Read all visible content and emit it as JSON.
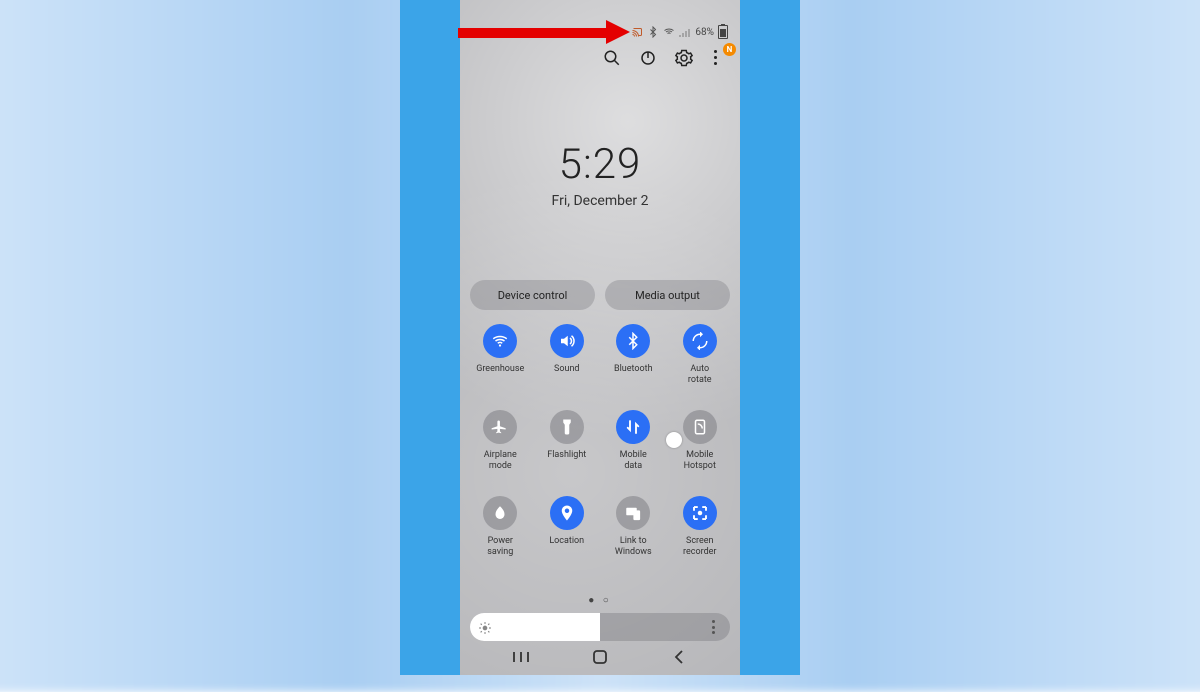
{
  "status": {
    "battery_pct": "68%",
    "badge_letter": "N"
  },
  "clock": {
    "time": "5:29",
    "date": "Fri, December 2"
  },
  "pills": {
    "device_control": "Device control",
    "media_output": "Media output"
  },
  "tiles": [
    {
      "id": "wifi",
      "label": "Greenhouse",
      "on": true
    },
    {
      "id": "sound",
      "label": "Sound",
      "on": true
    },
    {
      "id": "bluetooth",
      "label": "Bluetooth",
      "on": true
    },
    {
      "id": "auto-rotate",
      "label": "Auto\nrotate",
      "on": true
    },
    {
      "id": "airplane",
      "label": "Airplane\nmode",
      "on": false
    },
    {
      "id": "flashlight",
      "label": "Flashlight",
      "on": false
    },
    {
      "id": "mobile-data",
      "label": "Mobile\ndata",
      "on": true
    },
    {
      "id": "hotspot",
      "label": "Mobile\nHotspot",
      "on": false,
      "toggle_dot": true
    },
    {
      "id": "power-saving",
      "label": "Power\nsaving",
      "on": false
    },
    {
      "id": "location",
      "label": "Location",
      "on": true
    },
    {
      "id": "link-windows",
      "label": "Link to\nWindows",
      "on": false
    },
    {
      "id": "screen-rec",
      "label": "Screen\nrecorder",
      "on": true
    }
  ],
  "brightness_pct": 50
}
